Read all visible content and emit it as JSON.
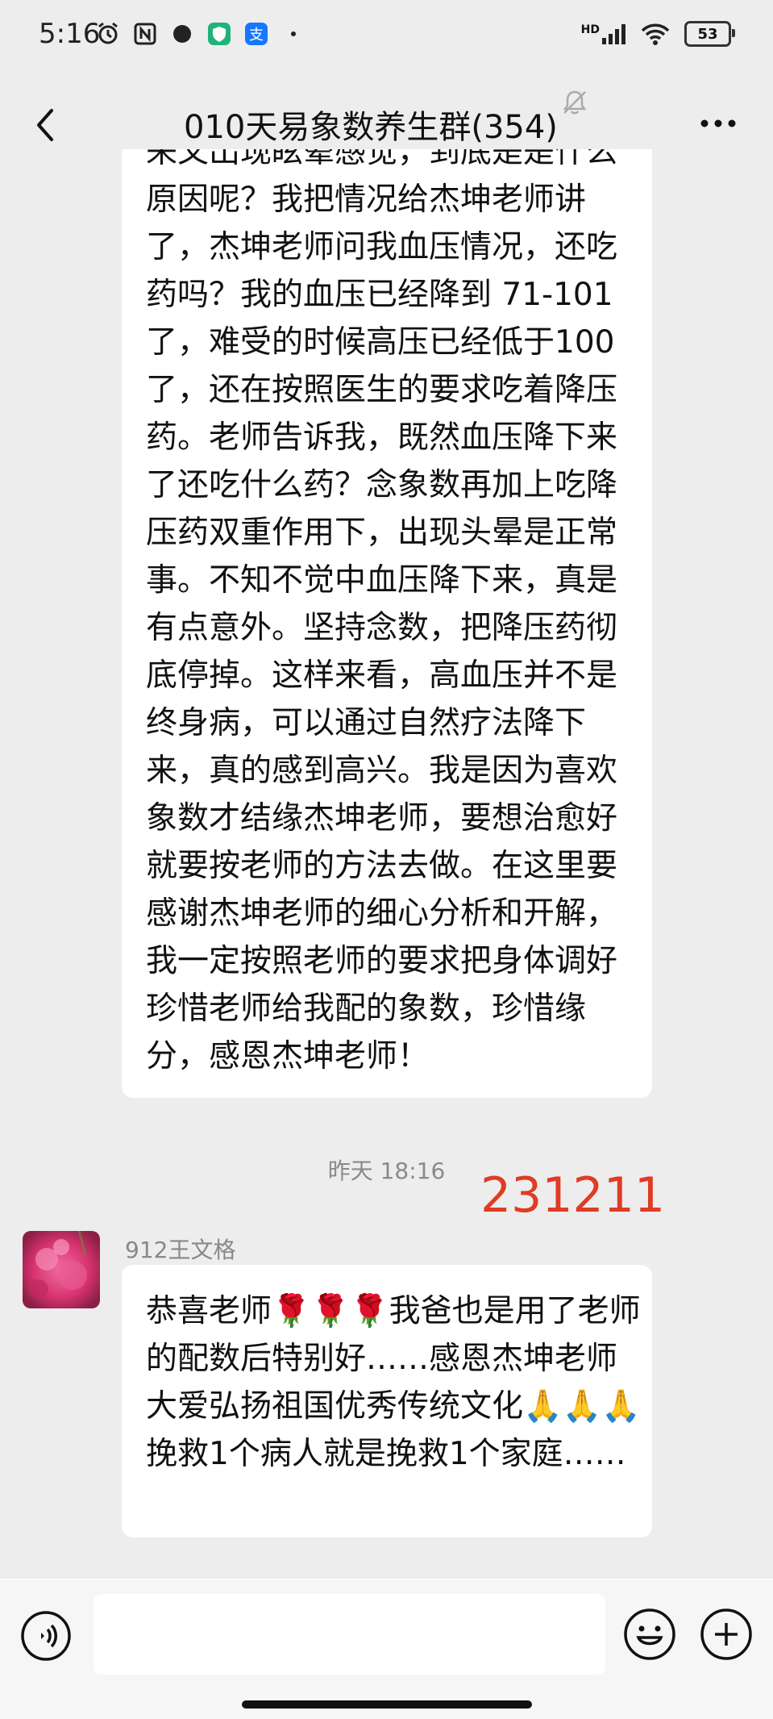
{
  "status_bar": {
    "time": "5:16",
    "battery": "53",
    "network": "HD"
  },
  "header": {
    "title": "010天易象数养生群(354)"
  },
  "messages": [
    {
      "text": "来又出现眩晕感觉，到底是是什么原因呢？我把情况给杰坤老师讲了，杰坤老师问我血压情况，还吃药吗？我的血压已经降到 71-101 了，难受的时候高压已经低于100了，还在按照医生的要求吃着降压药。老师告诉我，既然血压降下来了还吃什么药？念象数再加上吃降压药双重作用下，出现头晕是正常事。不知不觉中血压降下来，真是有点意外。坚持念数，把降压药彻底停掉。这样来看，高血压并不是终身病，可以通过自然疗法降下来，真的感到高兴。我是因为喜欢象数才结缘杰坤老师，要想治愈好就要按老师的方法去做。在这里要感谢杰坤老师的细心分析和开解，我一定按照老师的要求把身体调好珍惜老师给我配的象数，珍惜缘分，感恩杰坤老师！"
    },
    {
      "sender": "912王文格",
      "text": "恭喜老师🌹🌹🌹我爸也是用了老师的配数后特别好……感恩杰坤老师大爱弘扬祖国优秀传统文化🙏🙏🙏挽救1个病人就是挽救1个家庭……"
    }
  ],
  "timestamp": "昨天 18:16",
  "overlay_number": "231211",
  "colors": {
    "background": "#ededed",
    "bubble": "#ffffff",
    "overlay_number": "#e03b24"
  }
}
